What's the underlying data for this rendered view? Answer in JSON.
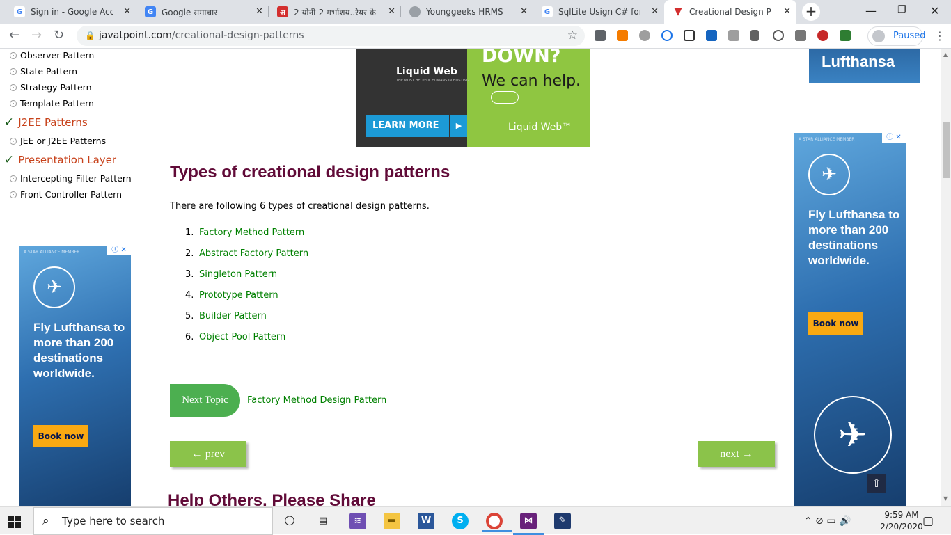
{
  "browser": {
    "tabs": [
      {
        "title": "Sign in - Google Accou",
        "favicon": "google-icon",
        "color": "#ffffff"
      },
      {
        "title": "Google समाचार",
        "favicon": "google-news-icon",
        "color": "#4285f4"
      },
      {
        "title": "2 योनी-2 गर्भाशय..रेयर के",
        "favicon": "amar-ujala-icon",
        "color": "#d32f2f"
      },
      {
        "title": "Younggeeks HRMS",
        "favicon": "globe-icon",
        "color": "#5f6368"
      },
      {
        "title": "SqlLite Usign C# for co",
        "favicon": "google-icon",
        "color": "#ffffff"
      },
      {
        "title": "Creational Design Patte",
        "favicon": "javatpoint-icon",
        "color": "#ffffff",
        "active": true
      }
    ],
    "url_domain": "javatpoint.com",
    "url_path": "/creational-design-patterns",
    "profile_label": "Paused"
  },
  "sidebar": {
    "items_top": [
      "Observer Pattern",
      "State Pattern",
      "Strategy Pattern",
      "Template Pattern"
    ],
    "heading_j2ee": "J2EE Patterns",
    "items_j2ee": [
      "JEE or J2EE Patterns"
    ],
    "heading_presentation": "Presentation Layer",
    "items_presentation": [
      "Intercepting Filter Pattern",
      "Front Controller Pattern"
    ]
  },
  "ad_liquidweb": {
    "brand": "Liquid Web",
    "tagline": "THE MOST HELPFUL HUMANS IN HOSTING",
    "headline": "DOWN?",
    "sub": "We can help.",
    "cta": "LEARN MORE",
    "brand_tm": "Liquid Web™"
  },
  "article": {
    "heading": "Types of creational design patterns",
    "intro": "There are following 6 types of creational design patterns.",
    "list": [
      {
        "num": "1.",
        "text": "Factory Method Pattern"
      },
      {
        "num": "2.",
        "text": "Abstract Factory Pattern"
      },
      {
        "num": "3.",
        "text": "Singleton Pattern"
      },
      {
        "num": "4.",
        "text": "Prototype Pattern"
      },
      {
        "num": "5.",
        "text": "Builder Pattern"
      },
      {
        "num": "6.",
        "text": "Object Pool Pattern"
      }
    ],
    "next_topic_label": "Next Topic",
    "next_topic_link": "Factory Method Design Pattern",
    "prev_label": "← prev",
    "next_label": "next →",
    "share_heading": "Help Others, Please Share"
  },
  "ad_lufthansa": {
    "star_alliance": "A STAR ALLIANCE MEMBER",
    "text": "Fly Lufthansa to more than 200 destinations worldwide.",
    "cta": "Book now",
    "brand": "Lufthansa"
  },
  "taskbar": {
    "search_placeholder": "Type here to search",
    "time": "9:59 AM",
    "date": "2/20/2020"
  }
}
